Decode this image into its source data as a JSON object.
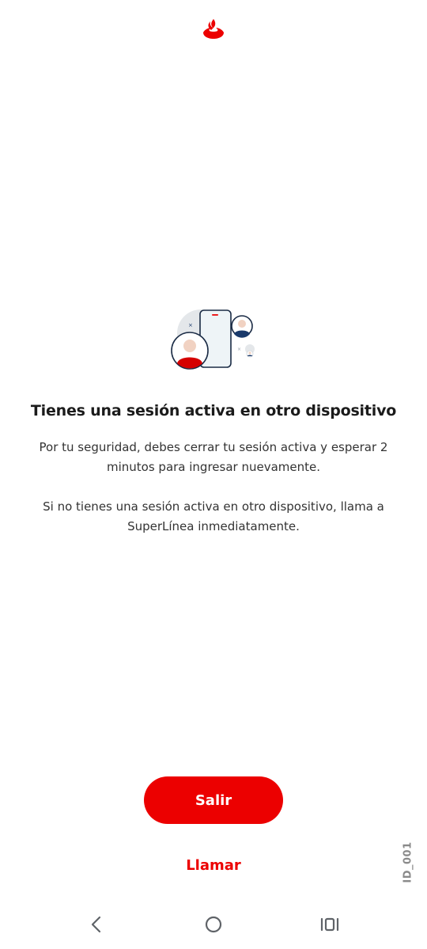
{
  "header": {
    "logo_icon": "santander-flame-icon",
    "brand_color": "#ec0000"
  },
  "illustration": {
    "icon": "multiple-devices-session-illustration"
  },
  "content": {
    "title": "Tienes una sesión activa en otro dispositivo",
    "paragraph1": "Por tu seguridad, debes cerrar tu sesión activa y esperar 2 minutos para ingresar nuevamente.",
    "paragraph2": "Si no tienes una sesión activa en otro dispositivo, llama a SuperLínea inmediatamente."
  },
  "actions": {
    "primary_label": "Salir",
    "secondary_label": "Llamar"
  },
  "watermark": {
    "id_text": "ID_001"
  },
  "system_nav": {
    "back_icon": "chevron-left-icon",
    "home_icon": "circle-home-icon",
    "recents_icon": "recent-apps-icon"
  }
}
